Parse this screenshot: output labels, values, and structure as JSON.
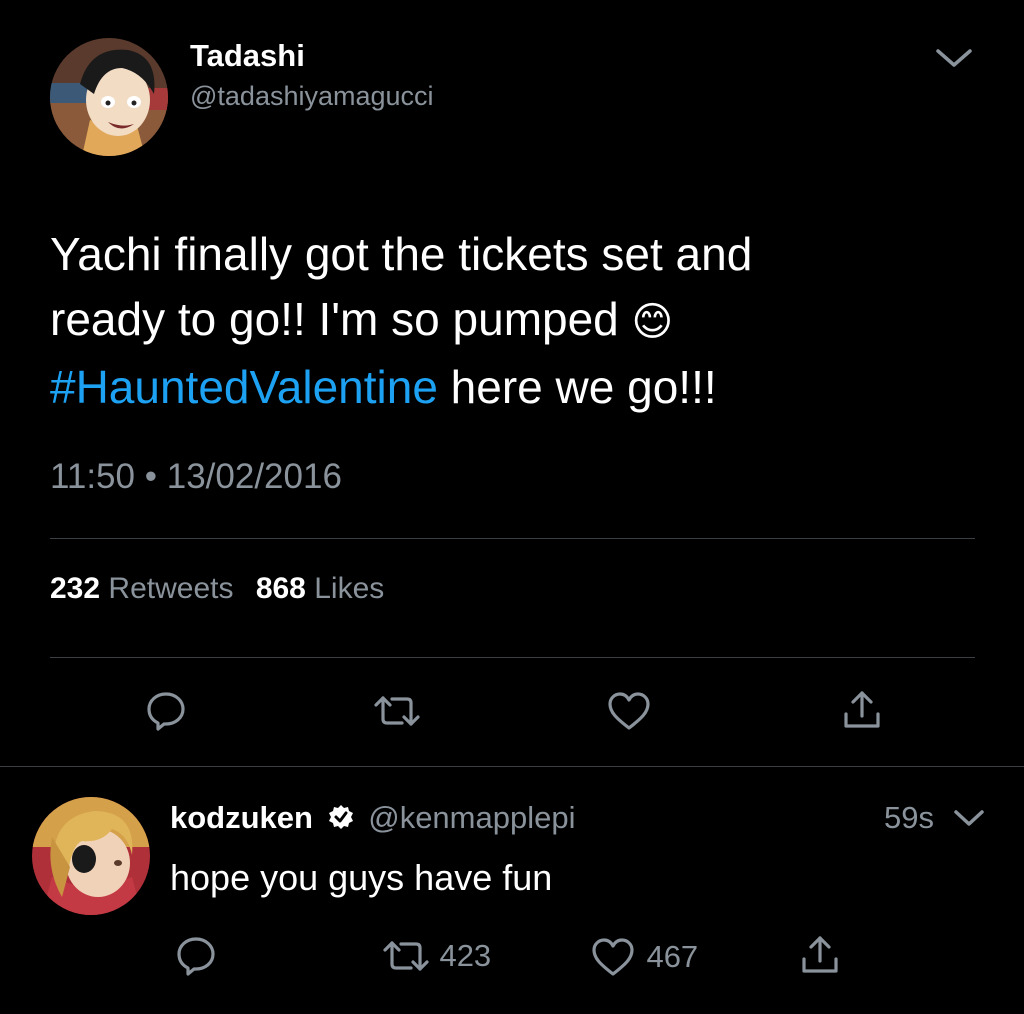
{
  "tweet": {
    "display_name": "Tadashi",
    "handle": "@tadashiyamagucci",
    "text_line1": "Yachi finally got the tickets set and",
    "text_line2": "ready to go!! I'm so pumped",
    "emoji": "😊",
    "hashtag": "#HauntedValentine",
    "text_after_hashtag": " here we go!!!",
    "time": "11:50",
    "separator": "•",
    "date": "13/02/2016",
    "retweets_count": "232",
    "retweets_label": "Retweets",
    "likes_count": "868",
    "likes_label": "Likes"
  },
  "reply": {
    "display_name": "kodzuken",
    "handle": "@kenmapplepi",
    "time_ago": "59s",
    "text": "hope you guys have fun",
    "retweet_count": "423",
    "like_count": "467"
  },
  "colors": {
    "background": "#000000",
    "text": "#ffffff",
    "muted": "#8a939b",
    "link": "#1da1f2",
    "divider": "#3a3f44"
  },
  "icons": {
    "chevron": "chevron-down-icon",
    "reply": "reply-icon",
    "retweet": "retweet-icon",
    "like": "heart-icon",
    "share": "share-icon",
    "verified": "verified-badge-icon"
  }
}
